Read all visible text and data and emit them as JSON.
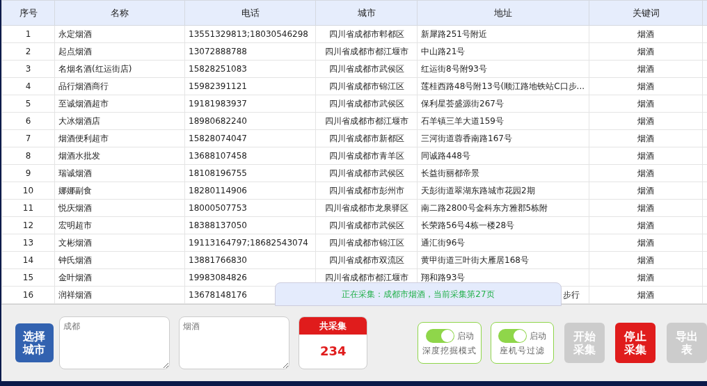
{
  "table": {
    "columns": [
      "序号",
      "名称",
      "电话",
      "城市",
      "地址",
      "关键词"
    ],
    "rows": [
      {
        "index": "1",
        "name": "永定烟酒",
        "phone": "13551329813;18030546298",
        "city": "四川省成都市郫都区",
        "address": "新犀路251号附近",
        "keyword": "烟酒"
      },
      {
        "index": "2",
        "name": "起点烟酒",
        "phone": "13072888788",
        "city": "四川省成都市都江堰市",
        "address": "中山路21号",
        "keyword": "烟酒"
      },
      {
        "index": "3",
        "name": "名烟名酒(红运街店)",
        "phone": "15828251083",
        "city": "四川省成都市武侯区",
        "address": "红运街8号附93号",
        "keyword": "烟酒"
      },
      {
        "index": "4",
        "name": "品行烟酒商行",
        "phone": "15982391121",
        "city": "四川省成都市锦江区",
        "address": "莲桂西路48号附13号(顺江路地铁站C口步...",
        "keyword": "烟酒"
      },
      {
        "index": "5",
        "name": "至诚烟酒超市",
        "phone": "19181983937",
        "city": "四川省成都市武侯区",
        "address": "保利星荟盛源街267号",
        "keyword": "烟酒"
      },
      {
        "index": "6",
        "name": "大冰烟酒店",
        "phone": "18980682240",
        "city": "四川省成都市都江堰市",
        "address": "石羊镇三羊大道159号",
        "keyword": "烟酒"
      },
      {
        "index": "7",
        "name": "烟酒便利超市",
        "phone": "15828074047",
        "city": "四川省成都市新都区",
        "address": "三河街道蓉香南路167号",
        "keyword": "烟酒"
      },
      {
        "index": "8",
        "name": "烟酒水批发",
        "phone": "13688107458",
        "city": "四川省成都市青羊区",
        "address": "同诚路448号",
        "keyword": "烟酒"
      },
      {
        "index": "9",
        "name": "瑞诚烟酒",
        "phone": "18108196755",
        "city": "四川省成都市武侯区",
        "address": "长益街丽都帝景",
        "keyword": "烟酒"
      },
      {
        "index": "10",
        "name": "娜娜副食",
        "phone": "18280114906",
        "city": "四川省成都市彭州市",
        "address": "天彭街道翠湖东路城市花园2期",
        "keyword": "烟酒"
      },
      {
        "index": "11",
        "name": "悦庆烟酒",
        "phone": "18000507753",
        "city": "四川省成都市龙泉驿区",
        "address": "南二路2800号金科东方雅郡5栋附",
        "keyword": "烟酒"
      },
      {
        "index": "12",
        "name": "宏明超市",
        "phone": "18388137050",
        "city": "四川省成都市武侯区",
        "address": "长荣路56号4栋一楼28号",
        "keyword": "烟酒"
      },
      {
        "index": "13",
        "name": "文彬烟酒",
        "phone": "19113164797;18682543074",
        "city": "四川省成都市锦江区",
        "address": "通汇街96号",
        "keyword": "烟酒"
      },
      {
        "index": "14",
        "name": "钟氏烟酒",
        "phone": "13881766830",
        "city": "四川省成都市双流区",
        "address": "黄甲街道三叶街大雁居168号",
        "keyword": "烟酒"
      },
      {
        "index": "15",
        "name": "金叶烟酒",
        "phone": "19983084826",
        "city": "四川省成都市都江堰市",
        "address": "翔和路93号",
        "keyword": "烟酒"
      },
      {
        "index": "16",
        "name": "润祥烟酒",
        "phone": "13678148176",
        "address_tail": "步行",
        "keyword": "烟酒"
      }
    ]
  },
  "status_toast": "正在采集：成都市烟酒，当前采集第27页",
  "city_button": {
    "lines": [
      "选择",
      "城市"
    ]
  },
  "city_input": {
    "placeholder": "成都"
  },
  "keyword_input": {
    "placeholder": "烟酒"
  },
  "counter": {
    "title": "共采集",
    "value": "234"
  },
  "toggles": [
    {
      "state_label": "启动",
      "caption": "深度挖掘模式",
      "on": true
    },
    {
      "state_label": "启动",
      "caption": "座机号过滤",
      "on": true
    }
  ],
  "action_buttons": [
    {
      "kind": "start",
      "lines": [
        "开始",
        "采集"
      ],
      "disabled": true
    },
    {
      "kind": "stop",
      "lines": [
        "停止",
        "采集"
      ],
      "disabled": false
    },
    {
      "kind": "export",
      "lines": [
        "导出",
        "表"
      ],
      "disabled": true
    }
  ]
}
